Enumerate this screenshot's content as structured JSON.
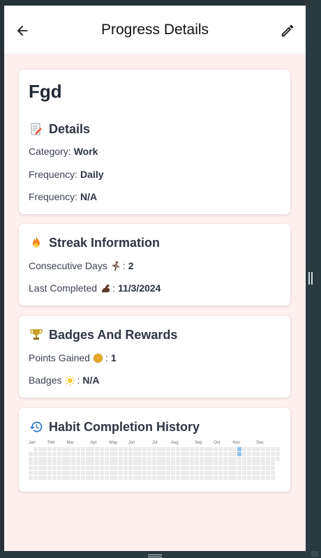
{
  "header": {
    "title": "Progress Details",
    "back_icon": "arrow-left-icon",
    "edit_icon": "pencil-icon"
  },
  "habit": {
    "name": "Fgd"
  },
  "details": {
    "title": "Details",
    "icon": "memo-icon",
    "category_label": "Category:",
    "category_value": "Work",
    "frequency_label": "Frequency:",
    "frequency_value": "Daily",
    "frequency2_label": "Frequency:",
    "frequency2_value": "N/A"
  },
  "streak": {
    "title": "Streak Information",
    "icon": "fire-icon",
    "consecutive_label": "Consecutive Days",
    "consecutive_value": "2",
    "last_completed_label": "Last Completed",
    "last_completed_value": "11/3/2024",
    "colon": ":"
  },
  "badges": {
    "title": "Badges And Rewards",
    "icon": "trophy-icon",
    "points_label": "Points Gained",
    "points_value": "1",
    "badges_label": "Badges",
    "badges_value": "N/A",
    "colon": ":"
  },
  "history": {
    "title": "Habit Completion History",
    "icon": "history-icon",
    "months": [
      "Jan",
      "Feb",
      "Mar",
      "Apr",
      "May",
      "Jun",
      "Jul",
      "Aug",
      "Sep",
      "Oct",
      "Nov",
      "Dec"
    ],
    "completed_days": [
      "2024-11-03",
      "2024-11-04"
    ]
  },
  "colors": {
    "accent_blue": "#1e6fd9",
    "heat_empty": "#ebebeb",
    "heat_filled": "#8fc1ea"
  }
}
